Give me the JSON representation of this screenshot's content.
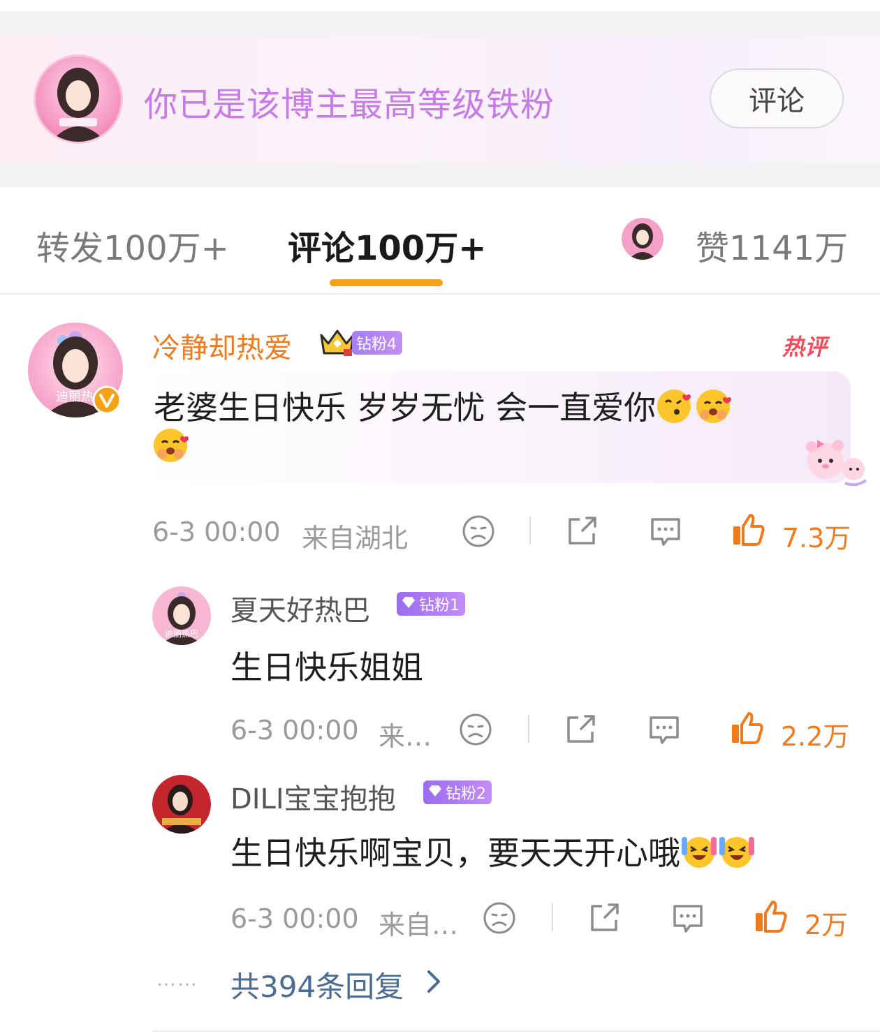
{
  "fan_banner": {
    "text": "你已是该博主最高等级铁粉",
    "button_label": "评论"
  },
  "tabs": {
    "repost": "转发100万+",
    "comment": "评论100万+",
    "like": "赞1141万"
  },
  "top_comment": {
    "username": "冷静却热爱",
    "badge": "钻粉4",
    "hot_label": "热评",
    "text_line1": "老婆生日快乐 岁岁无忧 会一直爱你",
    "time": "6-3 00:00",
    "location": "来自湖北",
    "likes": "7.3万"
  },
  "replies": [
    {
      "username": "夏天好热巴",
      "badge": "钻粉1",
      "text": "生日快乐姐姐",
      "time": "6-3 00:00",
      "location": "来…",
      "likes": "2.2万"
    },
    {
      "username": "DILI宝宝抱抱",
      "badge": "钻粉2",
      "text": "生日快乐啊宝贝，要天天开心哦",
      "time": "6-3 00:00",
      "location": "来自…",
      "likes": "2万"
    }
  ],
  "more_dots": "……",
  "more_replies": "共394条回复",
  "colors": {
    "fan_text": "#c77be6",
    "username_top": "#f07a1c",
    "like_orange": "#f07a1c",
    "tab_underline": "#f6a01a",
    "reply_link": "#4a6b93",
    "badge_purple": "#9b6cf0"
  }
}
